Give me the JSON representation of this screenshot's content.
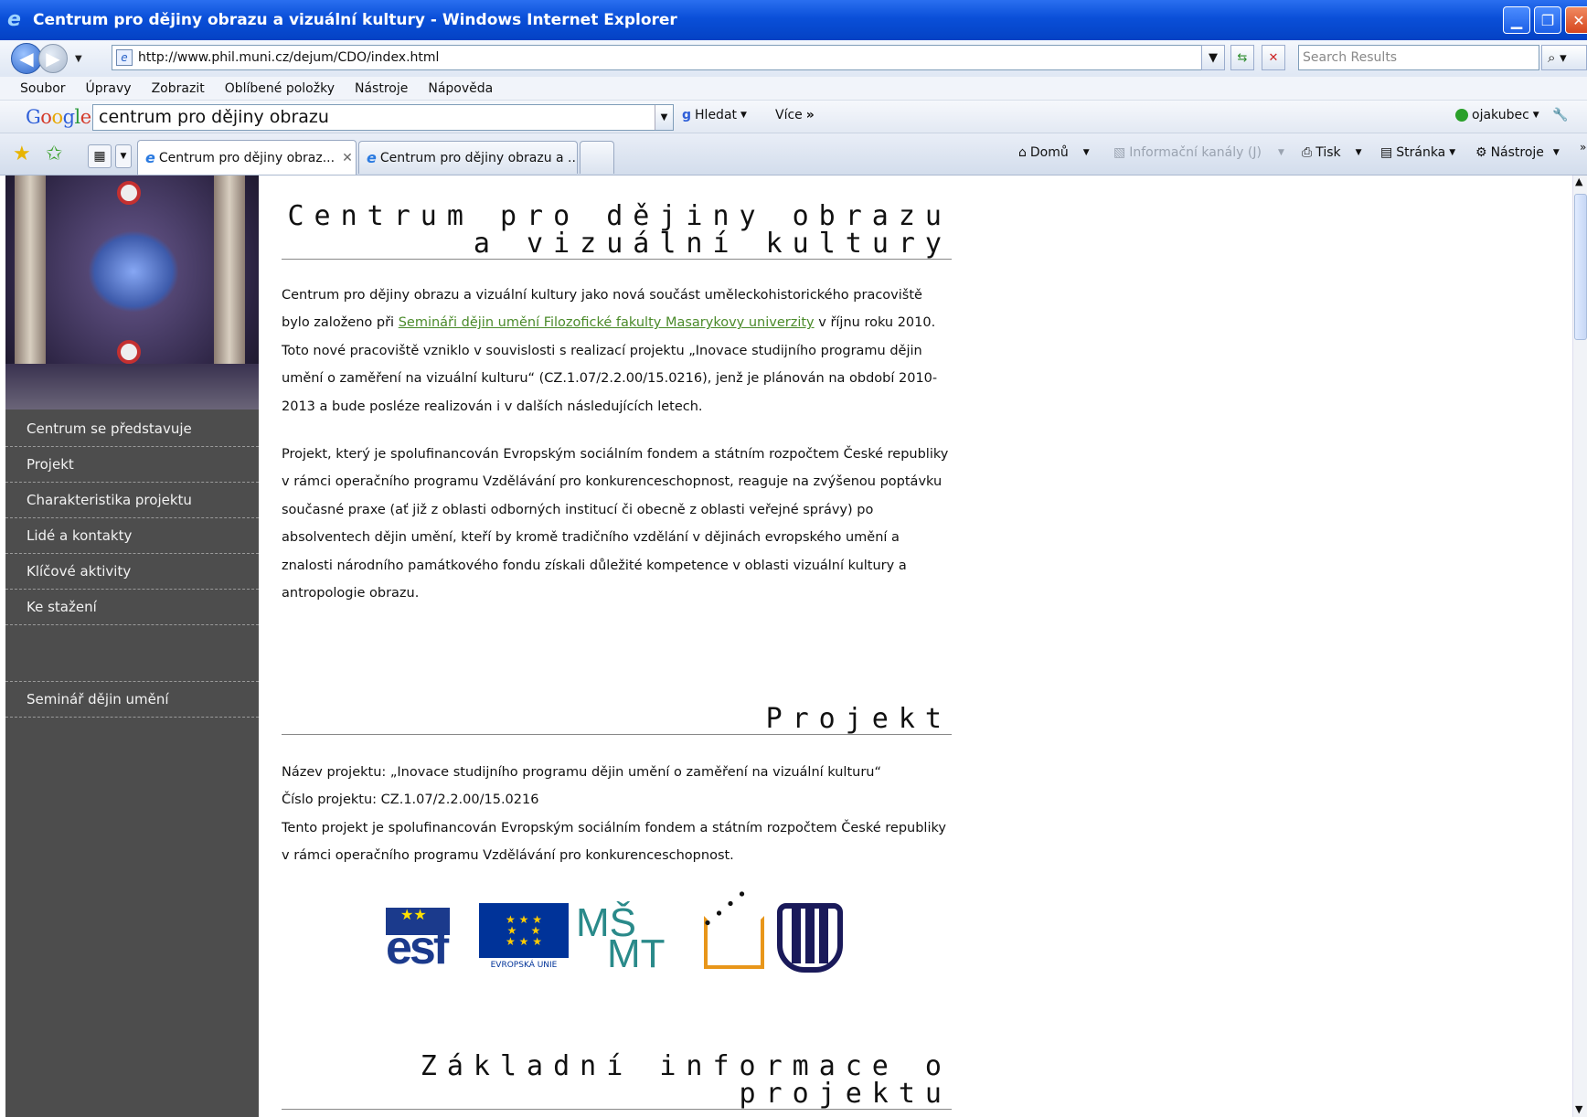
{
  "window": {
    "title": "Centrum pro dějiny obrazu a vizuální kultury - Windows Internet Explorer"
  },
  "address": {
    "url": "http://www.phil.muni.cz/dejum/CDO/index.html",
    "search_placeholder": "Search Results"
  },
  "menu": [
    "Soubor",
    "Úpravy",
    "Zobrazit",
    "Oblíbené položky",
    "Nástroje",
    "Nápověda"
  ],
  "google": {
    "logo": "Google",
    "query": "centrum pro dějiny obrazu",
    "search_label": "Hledat",
    "more_label": "Více",
    "user": "ojakubec"
  },
  "tabs": [
    {
      "label": "Centrum pro dějiny obraz...",
      "active": true
    },
    {
      "label": "Centrum pro dějiny obrazu a ...",
      "active": false
    }
  ],
  "commands": {
    "home": "Domů",
    "feeds": "Informační kanály (J)",
    "print": "Tisk",
    "page": "Stránka",
    "tools": "Nástroje"
  },
  "sidebar": {
    "items": [
      "Centrum se představuje",
      "Projekt",
      "Charakteristika projektu",
      "Lidé a kontakty",
      "Klíčové aktivity",
      "Ke stažení"
    ],
    "extra": "Seminář dějin umění"
  },
  "main": {
    "title_line1": "Centrum pro dějiny obrazu",
    "title_line2": "a vizuální kultury",
    "intro_a": "Centrum pro dějiny obrazu a vizuální kultury jako nová součást uměleckohistorického pracoviště bylo založeno při ",
    "intro_link": "Semináři dějin umění Filozofické fakulty Masarykovy univerzity",
    "intro_b": " v říjnu roku 2010. Toto nové pracoviště vzniklo v souvislosti s realizací projektu „Inovace studijního programu dějin umění o zaměření na vizuální kulturu“ (CZ.1.07/2.2.00/15.0216), jenž je plánován na období 2010-2013 a bude posléze realizován i v dalších následujících letech.",
    "para2": "Projekt, který je spolufinancován Evropským sociálním fondem a státním rozpočtem České republiky v rámci operačního programu Vzdělávání pro konkurenceschopnost, reaguje na zvýšenou poptávku současné praxe (ať již z oblasti odborných institucí či obecně z oblasti veřejné správy) po absolventech dějin umění, kteří by kromě tradičního vzdělání v dějinách evropského umění a znalosti národního památkového fondu získali důležité kompetence v oblasti vizuální kultury a antropologie obrazu.",
    "project_heading": "Projekt",
    "project_name": "Název projektu: „Inovace studijního programu dějin umění o zaměření na vizuální kulturu“",
    "project_number": "Číslo projektu: CZ.1.07/2.2.00/15.0216",
    "project_funding": "Tento projekt je spolufinancován Evropským sociálním fondem a státním rozpočtem České republiky v rámci operačního programu Vzdělávání pro konkurenceschopnost.",
    "basic_heading_line1": "Základní informace o",
    "basic_heading_line2": "projektu"
  },
  "logos": {
    "esf": "esf",
    "eu": "EVROPSKÁ UNIE",
    "msmt_a": "MŠ",
    "msmt_b": "MT"
  }
}
